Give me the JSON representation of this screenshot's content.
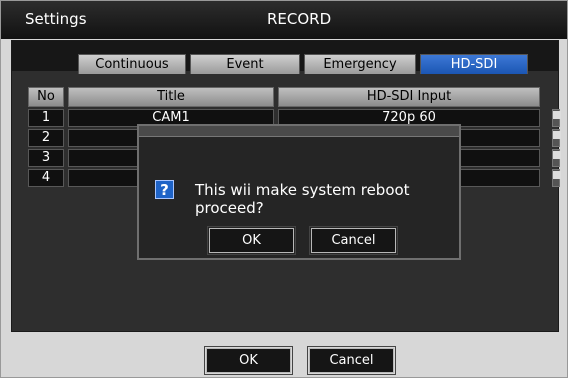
{
  "window": {
    "title_left": "Settings",
    "title_center": "RECORD"
  },
  "tabs": [
    {
      "label": "Continuous",
      "active": false
    },
    {
      "label": "Event",
      "active": false
    },
    {
      "label": "Emergency",
      "active": false
    },
    {
      "label": "HD-SDI",
      "active": true
    }
  ],
  "table": {
    "headers": [
      "No",
      "Title",
      "HD-SDI Input"
    ],
    "rows": [
      {
        "no": "1",
        "title": "CAM1",
        "input": "720p 60"
      },
      {
        "no": "2",
        "title": "",
        "input": ""
      },
      {
        "no": "3",
        "title": "",
        "input": ""
      },
      {
        "no": "4",
        "title": "",
        "input": ""
      }
    ]
  },
  "dialog": {
    "icon": "question-icon",
    "message": "This wii make system reboot proceed?",
    "ok_label": "OK",
    "cancel_label": "Cancel"
  },
  "footer": {
    "ok_label": "OK",
    "cancel_label": "Cancel"
  },
  "colors": {
    "active_tab": "#2a67c9",
    "dialog_bg": "#252525"
  }
}
